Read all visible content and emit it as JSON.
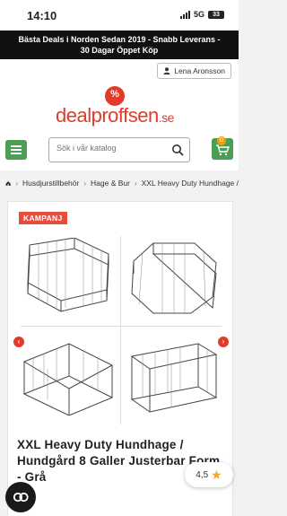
{
  "status_bar": {
    "time": "14:10",
    "network": "5G",
    "battery": "33"
  },
  "banner": {
    "line1": "Bästa Deals i Norden Sedan 2019 - Snabb Leverans -",
    "line2": "30 Dagar Öppet Köp"
  },
  "header": {
    "user_name": "Lena Aronsson",
    "logo_text": "dealproffsen",
    "logo_domain": ".se",
    "search_placeholder": "Sök i vår katalog",
    "cart_count": "0"
  },
  "breadcrumbs": [
    "Husdjurstillbehör",
    "Hage & Bur",
    "XXL Heavy Duty Hundhage /"
  ],
  "product": {
    "badge": "KAMPANJ",
    "title": "XXL Heavy Duty Hundhage / Hundgård 8 Galler Justerbar Form - Grå"
  },
  "rating": {
    "value": "4,5"
  },
  "colors": {
    "brand_red": "#e23b2a",
    "accent_green": "#4b9e54",
    "badge_orange": "#f39c12",
    "star": "#f5a623"
  }
}
